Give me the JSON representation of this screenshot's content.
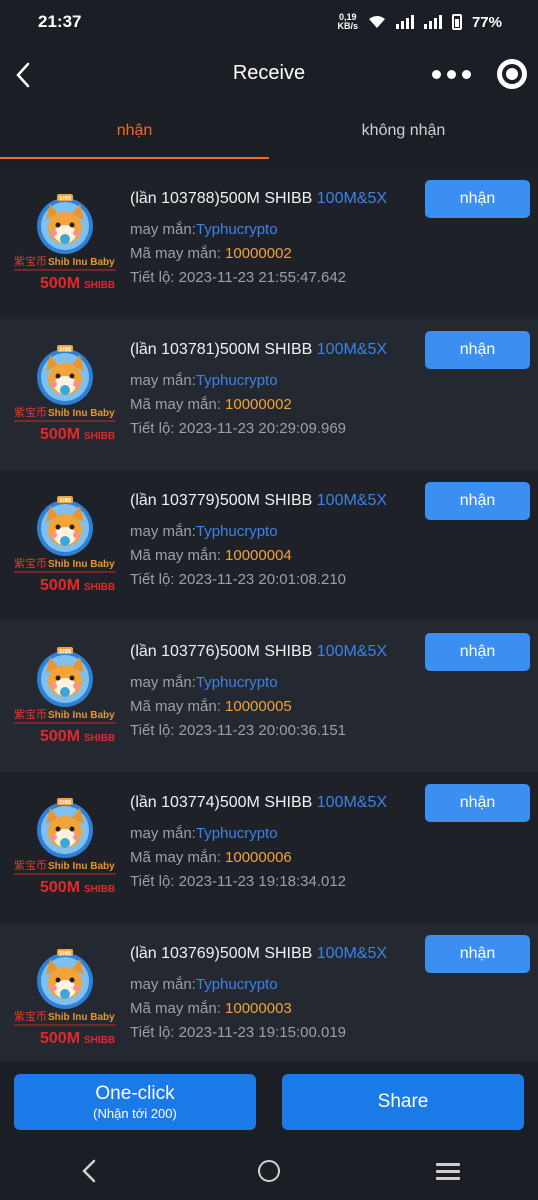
{
  "status": {
    "time": "21:37",
    "speed_value": "0,19",
    "speed_unit": "KB/s",
    "battery": "77%"
  },
  "header": {
    "title": "Receive"
  },
  "tabs": [
    {
      "label": "nhận",
      "active": true
    },
    {
      "label": "không nhận",
      "active": false
    }
  ],
  "labels": {
    "name_prefix": "may mắn:",
    "code_prefix": "Mã may mắn: ",
    "time_prefix": "Tiết lộ: ",
    "receive_button": "nhận",
    "logo_cn": "紫宝币",
    "logo_en": "Shib Inu Baby",
    "logo_amount": "500M",
    "logo_token": "SHIBB",
    "logo_badge": "SHIB"
  },
  "items": [
    {
      "title": "(lần 103788)500M SHIBB ",
      "highlight": "100M&5X",
      "name": "Typhucrypto",
      "code": "10000002",
      "time": "2023-11-23 21:55:47.642"
    },
    {
      "title": "(lần 103781)500M SHIBB ",
      "highlight": "100M&5X",
      "name": "Typhucrypto",
      "code": "10000002",
      "time": "2023-11-23 20:29:09.969"
    },
    {
      "title": "(lần 103779)500M SHIBB ",
      "highlight": "100M&5X",
      "name": "Typhucrypto",
      "code": "10000004",
      "time": "2023-11-23 20:01:08.210"
    },
    {
      "title": "(lần 103776)500M SHIBB ",
      "highlight": "100M&5X",
      "name": "Typhucrypto",
      "code": "10000005",
      "time": "2023-11-23 20:00:36.151"
    },
    {
      "title": "(lần 103774)500M SHIBB ",
      "highlight": "100M&5X",
      "name": "Typhucrypto",
      "code": "10000006",
      "time": "2023-11-23 19:18:34.012"
    },
    {
      "title": "(lần 103769)500M SHIBB ",
      "highlight": "100M&5X",
      "name": "Typhucrypto",
      "code": "10000003",
      "time": "2023-11-23 19:15:00.019"
    }
  ],
  "footer": {
    "oneclick_label": "One-click",
    "oneclick_sub": "(Nhận tới 200)",
    "share_label": "Share"
  },
  "colors": {
    "accent_tab": "#f26b22",
    "button_blue": "#3a8ff0",
    "link_blue": "#3c83e8",
    "code_orange": "#f0a23a"
  }
}
